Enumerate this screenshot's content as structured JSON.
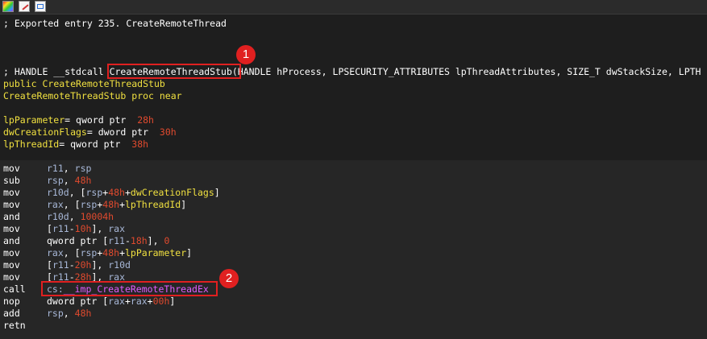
{
  "toolbar": {
    "icons": [
      "palette-icon",
      "edit-icon",
      "graph-icon"
    ]
  },
  "header_comment": "; Exported entry 235. CreateRemoteThread",
  "prototype": {
    "prefix": "; HANDLE __stdcall ",
    "name": "CreateRemoteThreadStub",
    "rest": "(HANDLE hProcess, LPSECURITY_ATTRIBUTES lpThreadAttributes, SIZE_T dwStackSize, LPTH"
  },
  "public_line": {
    "keyword": "public",
    "name": "CreateRemoteThreadStub"
  },
  "proc_line": {
    "name": "CreateRemoteThreadStub",
    "keyword": "proc near"
  },
  "locals": [
    {
      "name": "lpParameter",
      "op": "= qword ptr",
      "value": "28h"
    },
    {
      "name": "dwCreationFlags",
      "op": "= dword ptr",
      "value": "30h"
    },
    {
      "name": "lpThreadId",
      "op": "= qword ptr",
      "value": "38h"
    }
  ],
  "instructions": [
    {
      "mnem": "mov",
      "parts": [
        [
          "reg",
          "r11"
        ],
        [
          "white",
          ", "
        ],
        [
          "reg",
          "rsp"
        ]
      ]
    },
    {
      "mnem": "sub",
      "parts": [
        [
          "reg",
          "rsp"
        ],
        [
          "white",
          ", "
        ],
        [
          "num",
          "48h"
        ]
      ]
    },
    {
      "mnem": "mov",
      "parts": [
        [
          "reg",
          "r10d"
        ],
        [
          "white",
          ", ["
        ],
        [
          "reg",
          "rsp"
        ],
        [
          "white",
          "+"
        ],
        [
          "num",
          "48h"
        ],
        [
          "white",
          "+"
        ],
        [
          "var",
          "dwCreationFlags"
        ],
        [
          "white",
          "]"
        ]
      ]
    },
    {
      "mnem": "mov",
      "parts": [
        [
          "reg",
          "rax"
        ],
        [
          "white",
          ", ["
        ],
        [
          "reg",
          "rsp"
        ],
        [
          "white",
          "+"
        ],
        [
          "num",
          "48h"
        ],
        [
          "white",
          "+"
        ],
        [
          "var",
          "lpThreadId"
        ],
        [
          "white",
          "]"
        ]
      ]
    },
    {
      "mnem": "and",
      "parts": [
        [
          "reg",
          "r10d"
        ],
        [
          "white",
          ", "
        ],
        [
          "num",
          "10004h"
        ]
      ]
    },
    {
      "mnem": "mov",
      "parts": [
        [
          "white",
          "["
        ],
        [
          "reg",
          "r11"
        ],
        [
          "white",
          "-"
        ],
        [
          "num",
          "10h"
        ],
        [
          "white",
          "], "
        ],
        [
          "reg",
          "rax"
        ]
      ]
    },
    {
      "mnem": "and",
      "parts": [
        [
          "white",
          "qword ptr ["
        ],
        [
          "reg",
          "r11"
        ],
        [
          "white",
          "-"
        ],
        [
          "num",
          "18h"
        ],
        [
          "white",
          "], "
        ],
        [
          "num",
          "0"
        ]
      ]
    },
    {
      "mnem": "mov",
      "parts": [
        [
          "reg",
          "rax"
        ],
        [
          "white",
          ", ["
        ],
        [
          "reg",
          "rsp"
        ],
        [
          "white",
          "+"
        ],
        [
          "num",
          "48h"
        ],
        [
          "white",
          "+"
        ],
        [
          "var",
          "lpParameter"
        ],
        [
          "white",
          "]"
        ]
      ]
    },
    {
      "mnem": "mov",
      "parts": [
        [
          "white",
          "["
        ],
        [
          "reg",
          "r11"
        ],
        [
          "white",
          "-"
        ],
        [
          "num",
          "20h"
        ],
        [
          "white",
          "], "
        ],
        [
          "reg",
          "r10d"
        ]
      ]
    },
    {
      "mnem": "mov",
      "parts": [
        [
          "white",
          "["
        ],
        [
          "reg",
          "r11"
        ],
        [
          "white",
          "-"
        ],
        [
          "num",
          "28h"
        ],
        [
          "white",
          "], "
        ],
        [
          "reg",
          "rax"
        ]
      ]
    },
    {
      "mnem": "call",
      "parts": [
        [
          "reg",
          "cs:"
        ],
        [
          "import",
          "__imp_CreateRemoteThreadEx"
        ]
      ]
    },
    {
      "mnem": "nop",
      "parts": [
        [
          "white",
          "dword ptr ["
        ],
        [
          "reg",
          "rax"
        ],
        [
          "white",
          "+"
        ],
        [
          "reg",
          "rax"
        ],
        [
          "white",
          "+"
        ],
        [
          "num",
          "00h"
        ],
        [
          "white",
          "]"
        ]
      ]
    },
    {
      "mnem": "add",
      "parts": [
        [
          "reg",
          "rsp"
        ],
        [
          "white",
          ", "
        ],
        [
          "num",
          "48h"
        ]
      ]
    },
    {
      "mnem": "retn",
      "parts": []
    }
  ],
  "callouts": [
    {
      "number": "1"
    },
    {
      "number": "2"
    }
  ]
}
